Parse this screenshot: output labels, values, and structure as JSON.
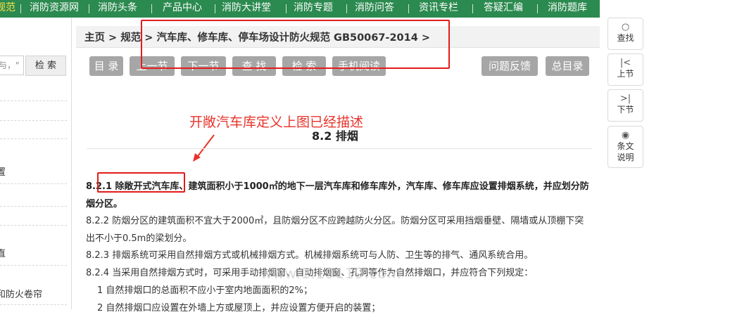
{
  "topnav": {
    "items": [
      "规范",
      "消防资源网",
      "消防头条",
      "产品中心",
      "消防大讲堂",
      "消防专题",
      "消防问答",
      "资讯专栏",
      "答疑汇编",
      "消防题库"
    ]
  },
  "left": {
    "search_placeholder": "与，\"",
    "search_button": "检 索",
    "items": [
      "置",
      "直",
      "和防火卷帘"
    ]
  },
  "breadcrumb": "主页 > 规范 > 汽车库、修车库、停车场设计防火规范 GB50067-2014 >",
  "toolbar": {
    "catalog": "目 录",
    "prev": "上一节",
    "next": "下一节",
    "find": "查 找",
    "search": "检 索",
    "mobile": "手机阅读",
    "feedback": "问题反馈",
    "all_catalog": "总目录"
  },
  "annotation": "开敞汽车库定义上图已经描述",
  "section_title": "8.2  排烟",
  "paragraphs": {
    "p1": "8.2.1 除敞开式汽车库、建筑面积小于1000㎡的地下一层汽车库和修车库外，汽车库、修车库应设置排烟系统，并应划分防烟分区。",
    "p2": "8.2.2 防烟分区的建筑面积不宜大于2000㎡，且防烟分区不应跨越防火分区。防烟分区可采用挡烟垂壁、隔墙或从顶棚下突出不小于0.5m的梁划分。",
    "p3": "8.2.3 排烟系统可采用自然排烟方式或机械排烟方式。机械排烟系统可与人防、卫生等的排气、通风系统合用。",
    "p4": "8.2.4 当采用自然排烟方式时，可采用手动排烟窗、自动排烟窗、孔洞等作为自然排烟口，并应符合下列规定：",
    "p5": "1 自然排烟口的总面积不应小于室内地面面积的2%；",
    "p6": "2 自然排烟口应设置在外墙上方或屋顶上，并应设置方便开启的装置；"
  },
  "watermark": "www.1.19119.com",
  "sidetools": {
    "find": "查找",
    "prev": "上节",
    "next": "下节",
    "explain_1": "条文",
    "explain_2": "说明",
    "find_icon": "search-icon",
    "prev_icon": "step-back-icon",
    "next_icon": "step-forward-icon",
    "explain_icon": "eye-icon"
  },
  "colors": {
    "nav_green": "#2b8a4f",
    "annotation_red": "#e8332b",
    "button_gray": "#a6a6a6"
  }
}
